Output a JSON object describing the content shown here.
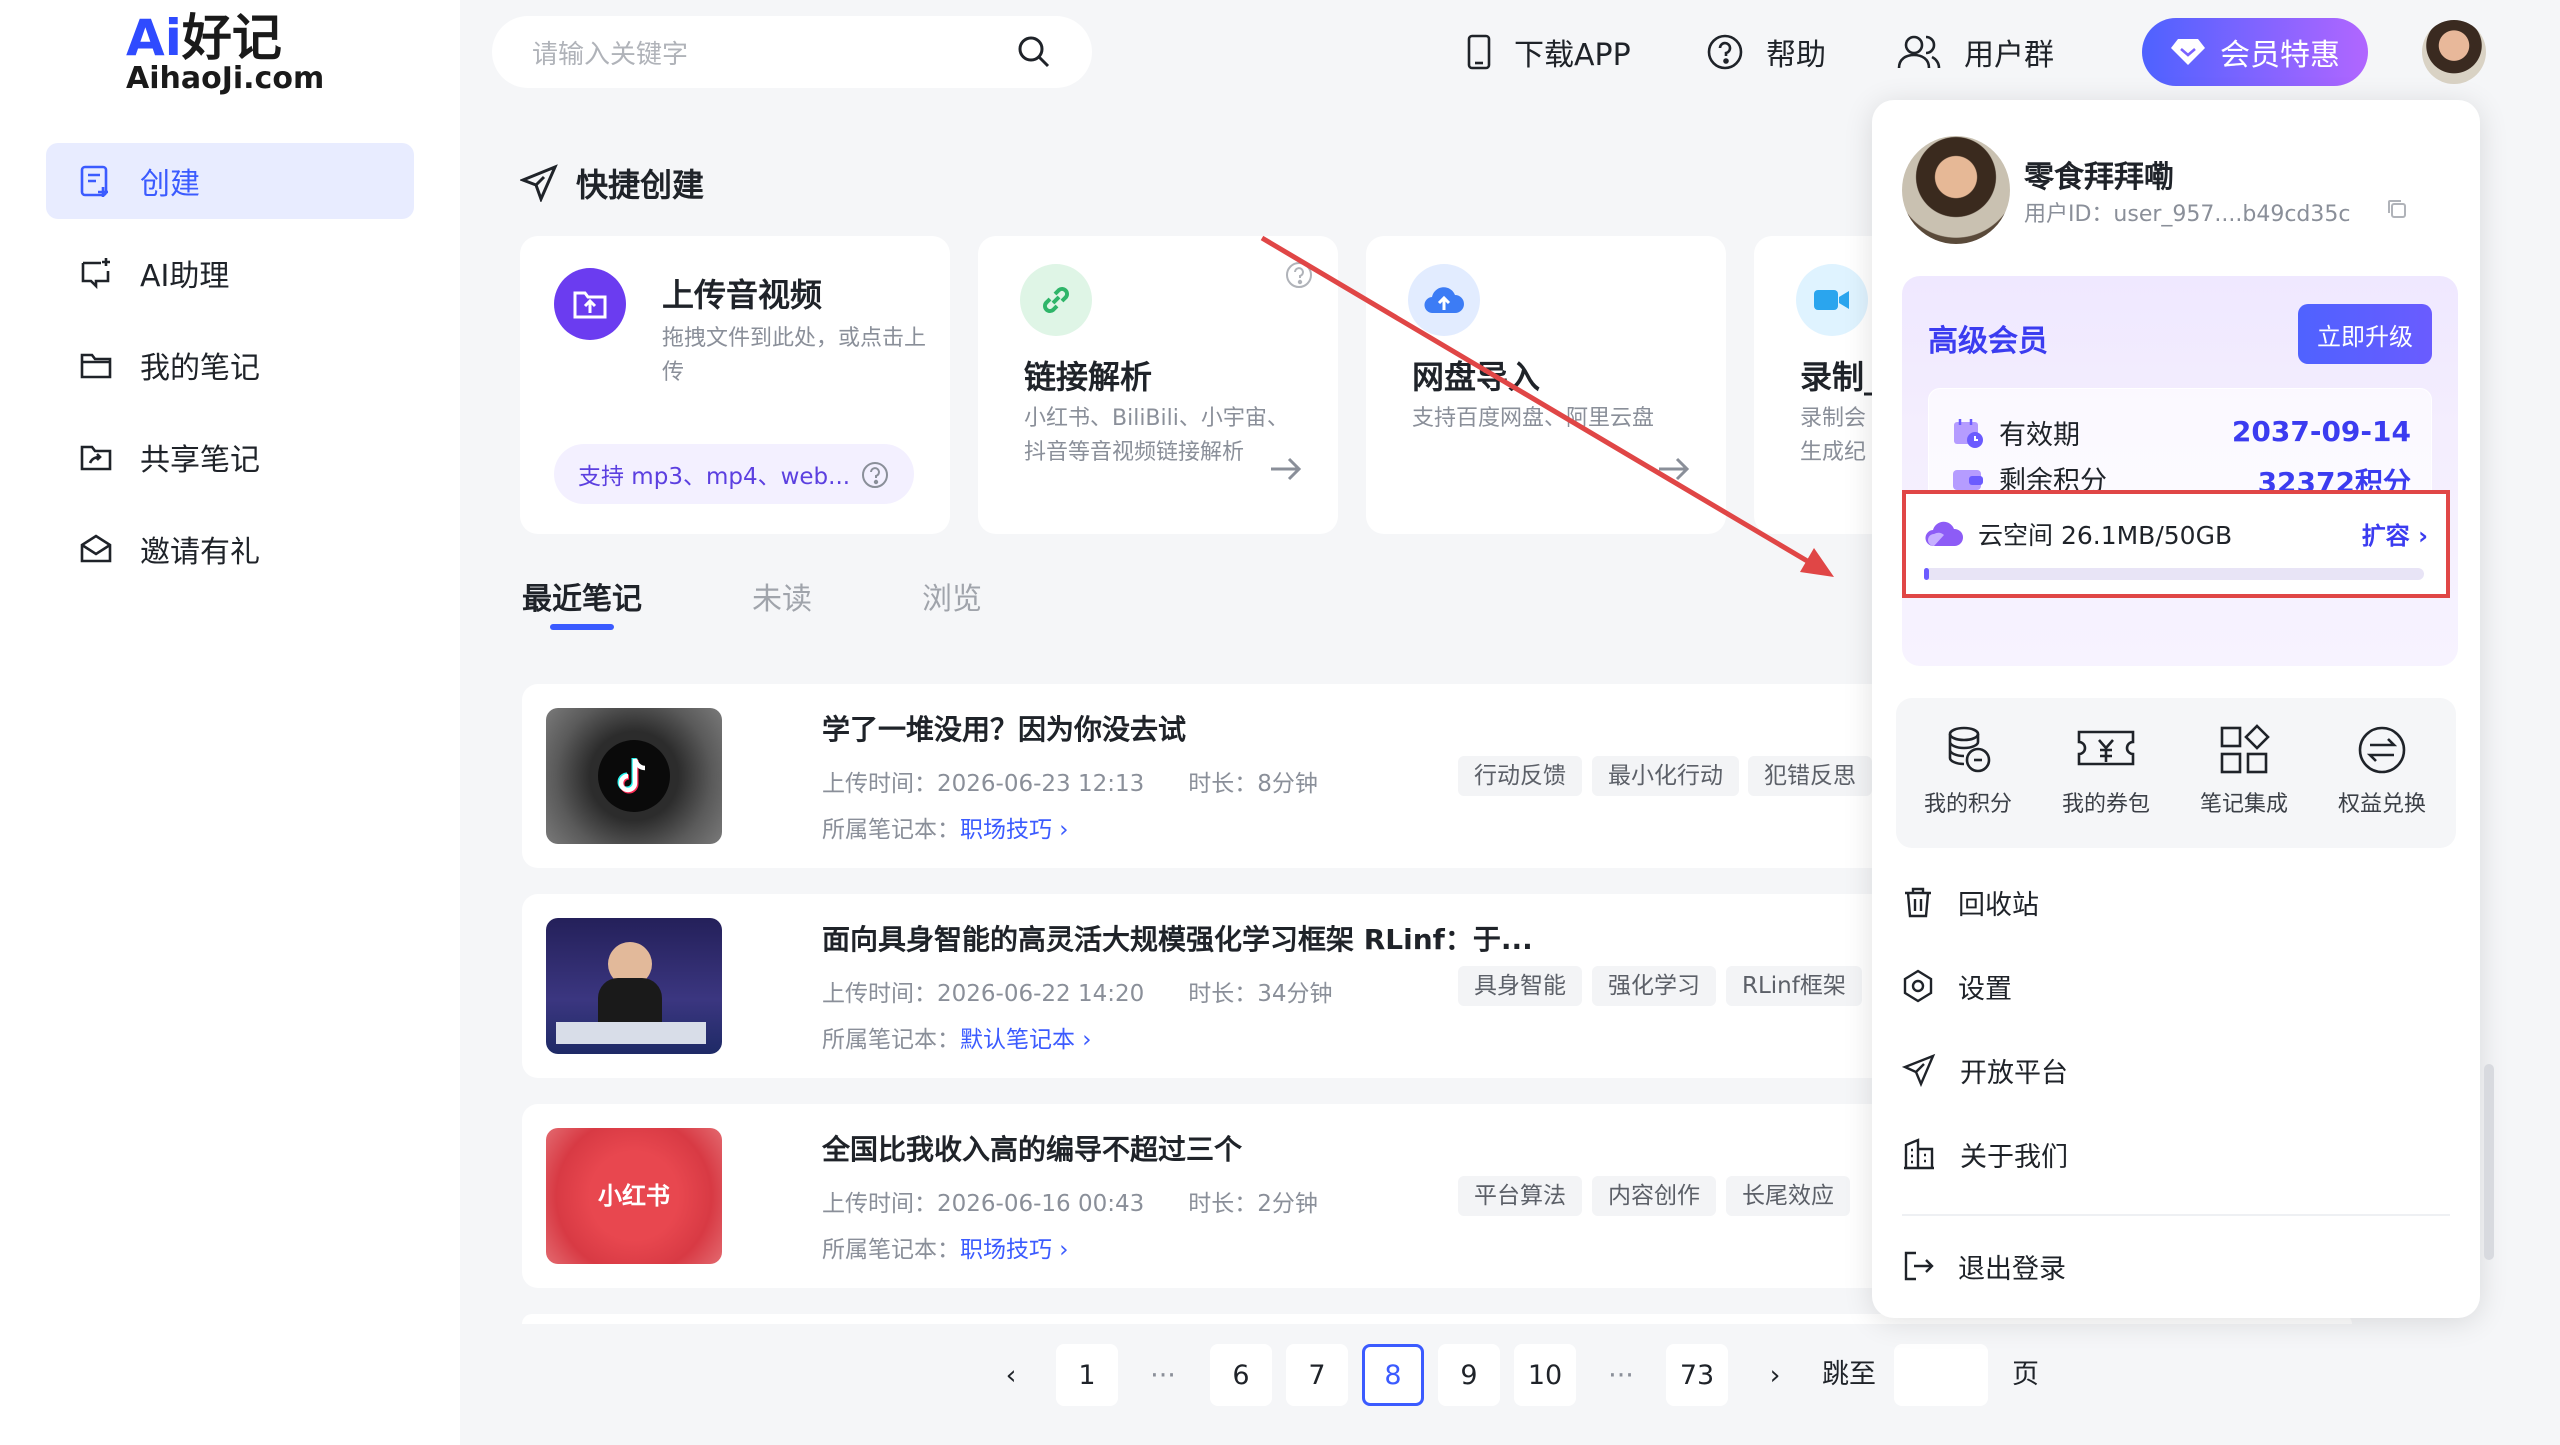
{
  "logo": {
    "line1_ai": "Ai",
    "line1_rest": "好记",
    "line2": "AihaoJi.com"
  },
  "sidebar": {
    "items": [
      {
        "label": "创建",
        "icon": "create-icon"
      },
      {
        "label": "AI助理",
        "icon": "ai-assistant-icon"
      },
      {
        "label": "我的笔记",
        "icon": "folder-icon"
      },
      {
        "label": "共享笔记",
        "icon": "shared-folder-icon"
      },
      {
        "label": "邀请有礼",
        "icon": "gift-mail-icon"
      }
    ]
  },
  "search": {
    "placeholder": "请输入关键字"
  },
  "topbar": {
    "download": "下载APP",
    "help": "帮助",
    "group": "用户群",
    "vip": "会员特惠"
  },
  "quick": {
    "title": "快捷创建",
    "upload": {
      "title": "上传音视频",
      "desc": "拖拽文件到此处，或点击上传",
      "formats": "支持 mp3、mp4、web..."
    },
    "link": {
      "title": "链接解析",
      "desc": "小红书、BiliBili、小宇宙、抖音等音视频链接解析"
    },
    "cloud": {
      "title": "网盘导入",
      "desc": "支持百度网盘、阿里云盘"
    },
    "record": {
      "title": "录制_",
      "desc": "录制会生成纪"
    }
  },
  "tabs": [
    "最近笔记",
    "未读",
    "浏览"
  ],
  "notes": [
    {
      "title": "学了一堆没用？因为你没去试",
      "time": "上传时间：2026-06-23 12:13",
      "duration": "时长：8分钟",
      "book_label": "所属笔记本：",
      "book": "职场技巧 ›",
      "tags": [
        "行动反馈",
        "最小化行动",
        "犯错反思"
      ]
    },
    {
      "title": "面向具身智能的高灵活大规模强化学习框架 RLinf：于...",
      "time": "上传时间：2026-06-22 14:20",
      "duration": "时长：34分钟",
      "book_label": "所属笔记本：",
      "book": "默认笔记本 ›",
      "tags": [
        "具身智能",
        "强化学习",
        "RLinf框架"
      ]
    },
    {
      "title": "全国比我收入高的编导不超过三个",
      "time": "上传时间：2026-06-16 00:43",
      "duration": "时长：2分钟",
      "book_label": "所属笔记本：",
      "book": "职场技巧 ›",
      "tags": [
        "平台算法",
        "内容创作",
        "长尾效应"
      ]
    }
  ],
  "thumb3_text": "小红书",
  "pager": {
    "pages": [
      "1",
      "6",
      "7",
      "8",
      "9",
      "10",
      "73"
    ],
    "current": "8",
    "jump": "跳至",
    "page_unit": "页",
    "prev": "‹",
    "next": "›",
    "ellipsis": "···"
  },
  "panel": {
    "name": "零食拜拜嘞",
    "uid": "用户ID：user_957....b49cd35c",
    "member_title": "高级会员",
    "upgrade": "立即升级",
    "expiry_label": "有效期",
    "expiry_value": "2037-09-14",
    "points_label": "剩余积分",
    "points_value": "32372积分",
    "cloud_label": "云空间 26.1MB/50GB",
    "cloud_expand": "扩容 ›",
    "cloud_usage_fraction": 0.0005,
    "quick": [
      "我的积分",
      "我的券包",
      "笔记集成",
      "权益兑换"
    ],
    "menu": [
      "回收站",
      "设置",
      "开放平台",
      "关于我们"
    ],
    "logout": "退出登录"
  },
  "colors": {
    "accent": "#3b5bff",
    "vip_start": "#4e62ff",
    "vip_end": "#b166ff",
    "highlight": "#e04646"
  }
}
